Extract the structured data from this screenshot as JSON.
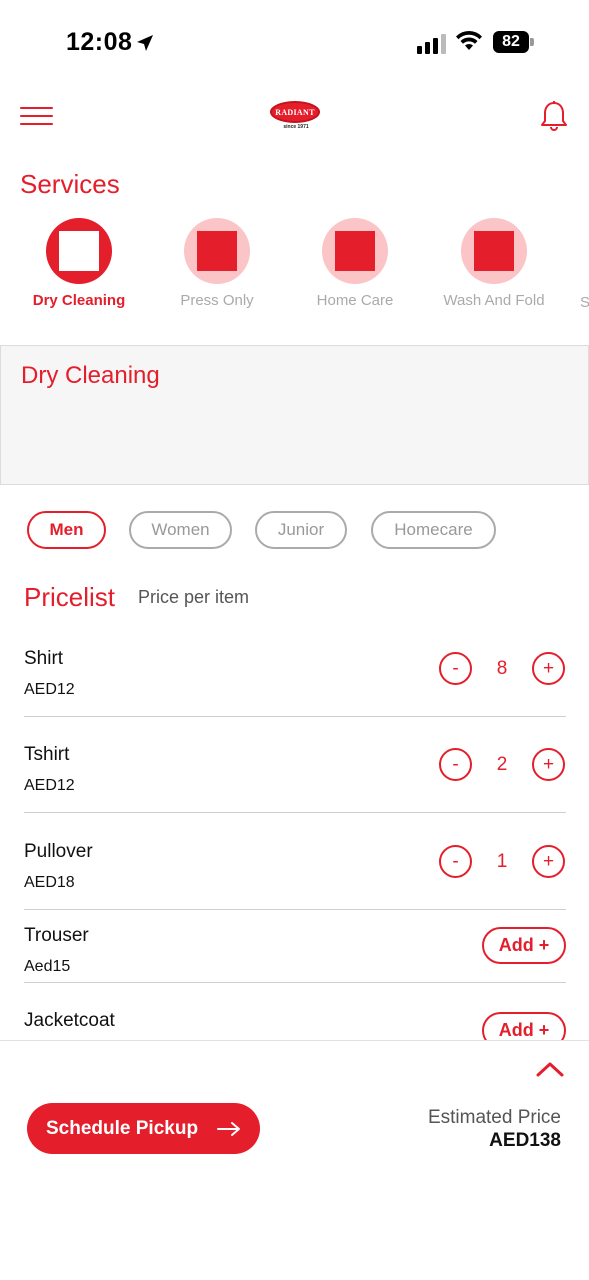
{
  "status_bar": {
    "time": "12:08",
    "battery": "82"
  },
  "header": {
    "logo_text": "RADIANT",
    "logo_sub": "since 1971",
    "menu_icon": "hamburger-menu-icon",
    "bell_icon": "bell-icon"
  },
  "services": {
    "title": "Services",
    "items": [
      {
        "label": "Dry Cleaning"
      },
      {
        "label": "Press Only"
      },
      {
        "label": "Home Care"
      },
      {
        "label": "Wash And Fold"
      },
      {
        "label": "S"
      }
    ]
  },
  "selected_service": {
    "title": "Dry Cleaning"
  },
  "categories": [
    "Men",
    "Women",
    "Junior",
    "Homecare"
  ],
  "pricelist": {
    "title": "Pricelist",
    "subtitle": "Price per item",
    "items": [
      {
        "name": "Shirt",
        "price": "AED12",
        "qty": "8",
        "minus": "-",
        "plus": "+"
      },
      {
        "name": "Tshirt",
        "price": "AED12",
        "qty": "2",
        "minus": "-",
        "plus": "+"
      },
      {
        "name": "Pullover",
        "price": "AED18",
        "qty": "1",
        "minus": "-",
        "plus": "+"
      },
      {
        "name": "Trouser",
        "price": "Aed15",
        "add": "Add +"
      },
      {
        "name": "Jacketcoat",
        "add": "Add +"
      }
    ]
  },
  "footer": {
    "schedule_label": "Schedule Pickup",
    "estimated_label": "Estimated Price",
    "estimated_value": "AED138"
  },
  "colors": {
    "accent": "#e41e2b",
    "accent_light": "#fbc4c7",
    "muted": "#aaaaaa"
  }
}
